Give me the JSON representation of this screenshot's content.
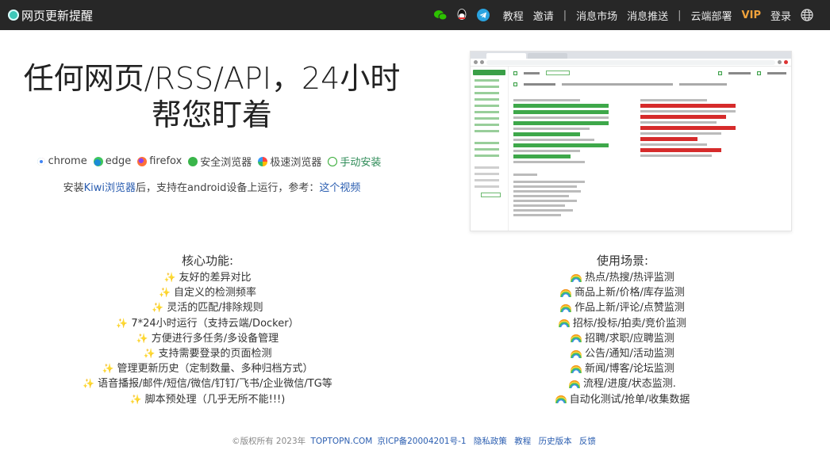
{
  "nav": {
    "brand": "网页更新提醒",
    "links": [
      "教程",
      "邀请"
    ],
    "links2": [
      "消息市场",
      "消息推送"
    ],
    "cloud": "云端部署",
    "vip": "VIP",
    "login": "登录",
    "sep": "|"
  },
  "hero": {
    "title_line1": "任何网页/RSS/API，24小时",
    "title_line2": "帮您盯着"
  },
  "browsers": [
    {
      "label": "chrome",
      "icon": "chrome-icon"
    },
    {
      "label": "edge",
      "icon": "edge-icon"
    },
    {
      "label": "firefox",
      "icon": "firefox-icon"
    },
    {
      "label": "安全浏览器",
      "icon": "safe-browser-icon"
    },
    {
      "label": "极速浏览器",
      "icon": "fast-browser-icon"
    },
    {
      "label": "手动安装",
      "icon": "manual-install-icon"
    }
  ],
  "kiwi": {
    "prefix": "安装",
    "link": "Kiwi浏览器",
    "middle": "后，支持在android设备上运行，参考：",
    "video": "这个视频"
  },
  "features": {
    "core_title": "核心功能:",
    "core": [
      "友好的差异对比",
      "自定义的检测频率",
      "灵活的匹配/排除规则",
      "7*24小时运行（支持云端/Docker）",
      "方便进行多任务/多设备管理",
      "支持需要登录的页面检测",
      "管理更新历史（定制数量、多种归档方式）",
      "语音播报/邮件/短信/微信/钉钉/飞书/企业微信/TG等",
      "脚本预处理（几乎无所不能!!!)"
    ],
    "use_title": "使用场景:",
    "use": [
      "热点/热搜/热评监测",
      "商品上新/价格/库存监测",
      "作品上新/评论/点赞监测",
      "招标/投标/拍卖/竞价监测",
      "招聘/求职/应聘监测",
      "公告/通知/活动监测",
      "新闻/博客/论坛监测",
      "流程/进度/状态监测.",
      "自动化测试/抢单/收集数据"
    ]
  },
  "footer": {
    "copyright": "©版权所有 2023年",
    "site": "TOPTOPN.COM",
    "icp": "京ICP备20004201号-1",
    "links": [
      "隐私政策",
      "教程",
      "历史版本",
      "反馈"
    ]
  },
  "colors": {
    "navbar": "#272727",
    "vip": "#f0a23b",
    "link": "#2a5db0",
    "accent_green": "#3a9f47"
  }
}
